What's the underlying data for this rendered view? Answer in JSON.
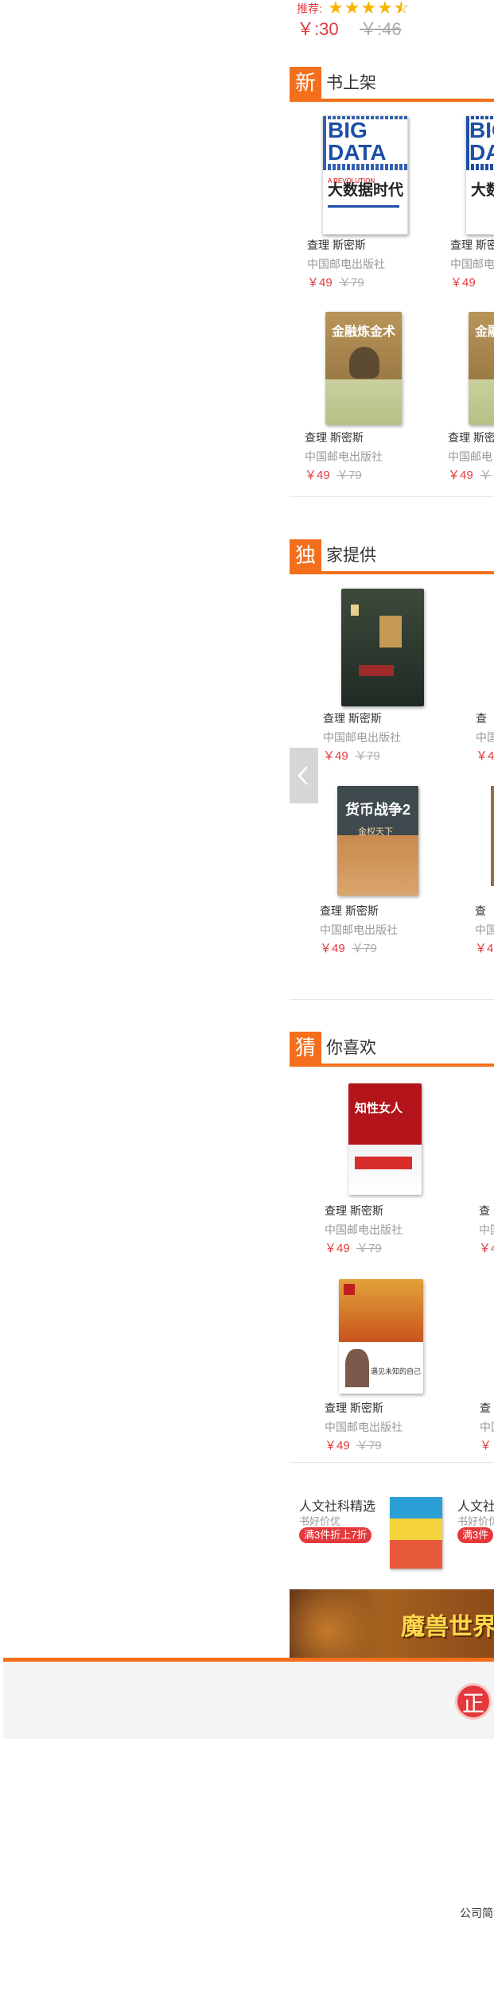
{
  "top": {
    "recommend_label": "推荐:",
    "rating": "4.5 / 5",
    "price_now": "￥:30",
    "price_old": "￥:46"
  },
  "sections": [
    {
      "badge": "新",
      "title": "书上架"
    },
    {
      "badge": "独",
      "title": "家提供"
    },
    {
      "badge": "猜",
      "title": "你喜欢"
    }
  ],
  "book_author": "查理 斯密斯",
  "book_publisher": "中国邮电出版社",
  "book_price_now": "￥49",
  "book_price_old": "￥79",
  "book_price_now_short": "￥49",
  "book_author_short": "查理 斯密",
  "book_author_cut": "查",
  "book_publisher_cut": "中国",
  "book_publisher_mid": "中国邮电",
  "book_price_cut": "￥4",
  "book_price_cut2": "￥",
  "covers": {
    "big_data_title": "大数据时代",
    "big_data_en": "BIG DATA",
    "big_data_sub": "A REVOLUTION",
    "jinrong_title": "金融炼金术",
    "huobi_title": "货币战争2",
    "huobi_sub": "金权天下",
    "zhili_title": "知性女人",
    "ertong_title": "遇见未知的自己"
  },
  "promo": {
    "title": "人文社科精选",
    "sub": "书好价优",
    "tag": "满3件折上7折",
    "title2": "人文社",
    "sub2": "书好价优",
    "tag2": "满3件"
  },
  "banner_text": "魔兽世界",
  "footer": {
    "badge": "正",
    "link": "公司简"
  },
  "colors": {
    "accent": "#f36f1b",
    "price": "#e4393c",
    "star": "#f6b400"
  }
}
